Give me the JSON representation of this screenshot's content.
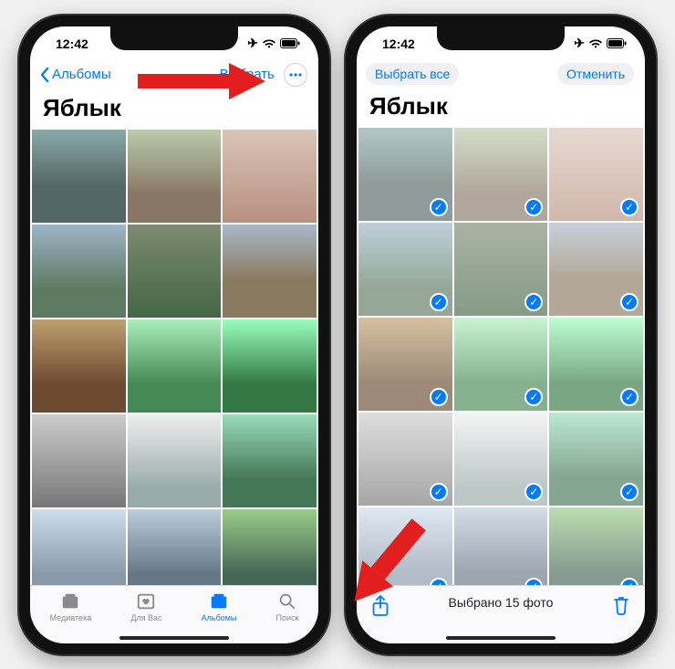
{
  "statusbar": {
    "time": "12:42"
  },
  "left": {
    "nav": {
      "back": "Альбомы",
      "select": "Выбрать"
    },
    "title": "Яблык",
    "tabs": {
      "library": "Медиатека",
      "foryou": "Для Вас",
      "albums": "Альбомы",
      "search": "Поиск"
    }
  },
  "right": {
    "nav": {
      "select_all": "Выбрать все",
      "cancel": "Отменить"
    },
    "title": "Яблык",
    "selection_text": "Выбрано 15 фото"
  },
  "colors": {
    "accent": "#007aff"
  }
}
